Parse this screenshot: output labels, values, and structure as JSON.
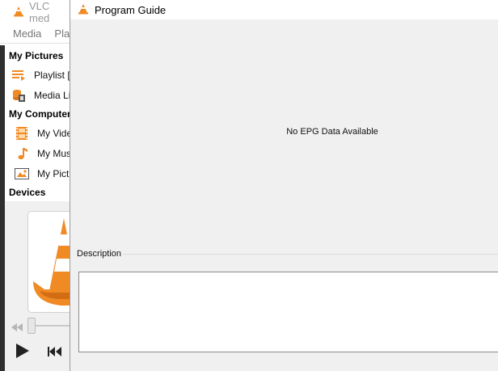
{
  "vlc": {
    "title": "VLC med",
    "menu": [
      "Media",
      "Play"
    ],
    "sidebar": {
      "sections": [
        {
          "label": "My Pictures"
        },
        {
          "label": "My Computer"
        },
        {
          "label": "Devices"
        }
      ],
      "items": [
        {
          "label": "Playlist [",
          "icon": "playlist-icon"
        },
        {
          "label": "Media Li",
          "icon": "media-library-icon"
        },
        {
          "label": "My Vide",
          "icon": "videos-icon"
        },
        {
          "label": "My Mus",
          "icon": "music-icon"
        },
        {
          "label": "My Pict",
          "icon": "pictures-icon"
        }
      ]
    },
    "accent": "#f08a24"
  },
  "dialog": {
    "title": "Program Guide",
    "epg_message": "No EPG Data Available",
    "description_label": "Description",
    "description_text": ""
  }
}
